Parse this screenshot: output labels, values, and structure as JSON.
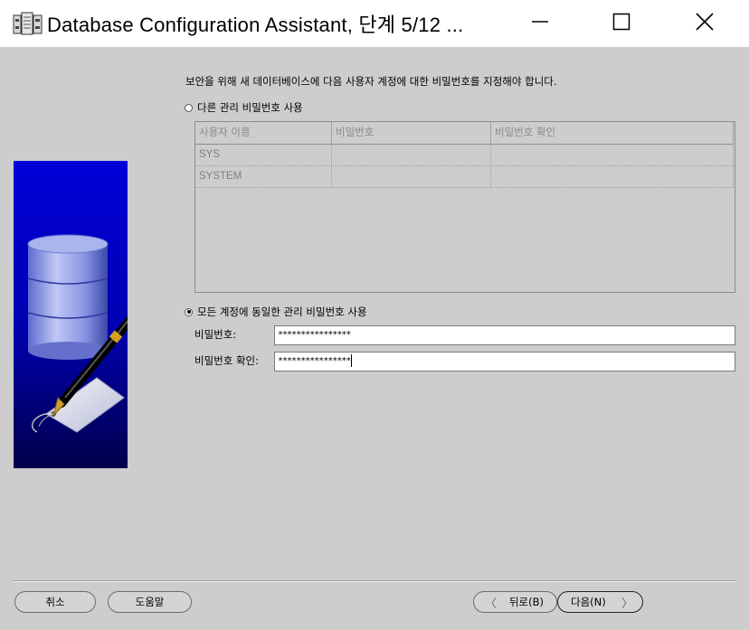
{
  "window": {
    "title": "Database Configuration Assistant, 단계 5/12 ..."
  },
  "content": {
    "instruction": "보안을 위해 새 데이터베이스에 다음 사용자 계정에 대한 비밀번호를 지정해야 합니다.",
    "radio_other": {
      "label": "다른 관리 비밀번호 사용",
      "checked": false
    },
    "table": {
      "columns": [
        "사용자 이름",
        "비밀번호",
        "비밀번호 확인"
      ],
      "rows": [
        [
          "SYS",
          "",
          ""
        ],
        [
          "SYSTEM",
          "",
          ""
        ]
      ]
    },
    "radio_same": {
      "label": "모든 계정에 동일한 관리 비밀번호 사용",
      "checked": true
    },
    "password_label": "비밀번호:",
    "password_value": "****************",
    "confirm_label": "비밀번호 확인:",
    "confirm_value": "****************"
  },
  "buttons": {
    "cancel": "취소",
    "help": "도움말",
    "back": "뒤로(B)",
    "next": "다음(N)"
  },
  "icons": {
    "app": "database-app-icon",
    "minimize": "minimize-icon",
    "maximize": "maximize-icon",
    "close": "close-icon",
    "back_chevron": "chevron-left-icon",
    "next_chevron": "chevron-right-icon",
    "side_image": "database-pen-illustration"
  },
  "colors": {
    "dialog_bg": "#cdcdcd",
    "side_image_blue": "#0000c8"
  }
}
